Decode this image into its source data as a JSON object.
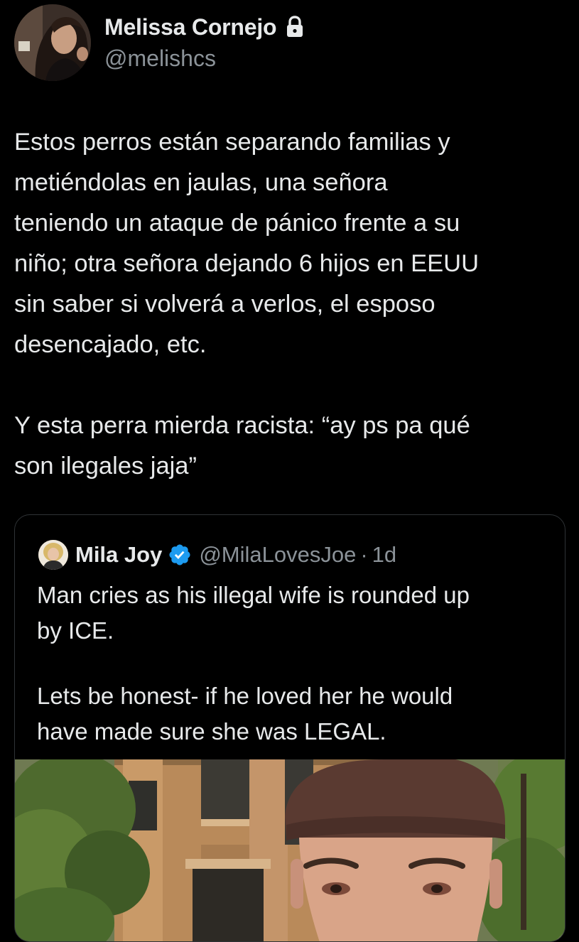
{
  "author": {
    "name": "Melissa Cornejo",
    "handle": "@melishcs",
    "protected_icon": "lock-icon"
  },
  "tweet": {
    "lines_p1": [
      "Estos perros están separando familias y",
      "metiéndolas en jaulas, una señora",
      "teniendo un ataque de pánico frente a su",
      "niño; otra señora dejando 6 hijos en EEUU",
      "sin saber si volverá a verlos, el esposo",
      "desencajado, etc."
    ],
    "lines_p2": [
      "Y esta perra mierda racista: “ay ps pa qué",
      "son ilegales jaja”"
    ]
  },
  "quoted": {
    "name": "Mila Joy",
    "verified_icon": "verified-badge-icon",
    "handle": "@MilaLovesJoe",
    "dot": "·",
    "time": "1d",
    "lines_p1": [
      "Man cries as his illegal wife is rounded up",
      "by ICE."
    ],
    "lines_p2": [
      "Lets be honest- if he loved her he would",
      "have made sure she was LEGAL."
    ]
  },
  "colors": {
    "background": "#000000",
    "text": "#e7e9ea",
    "secondary": "#8b9298",
    "border": "#2f3336",
    "verified": "#1d9bf0"
  }
}
